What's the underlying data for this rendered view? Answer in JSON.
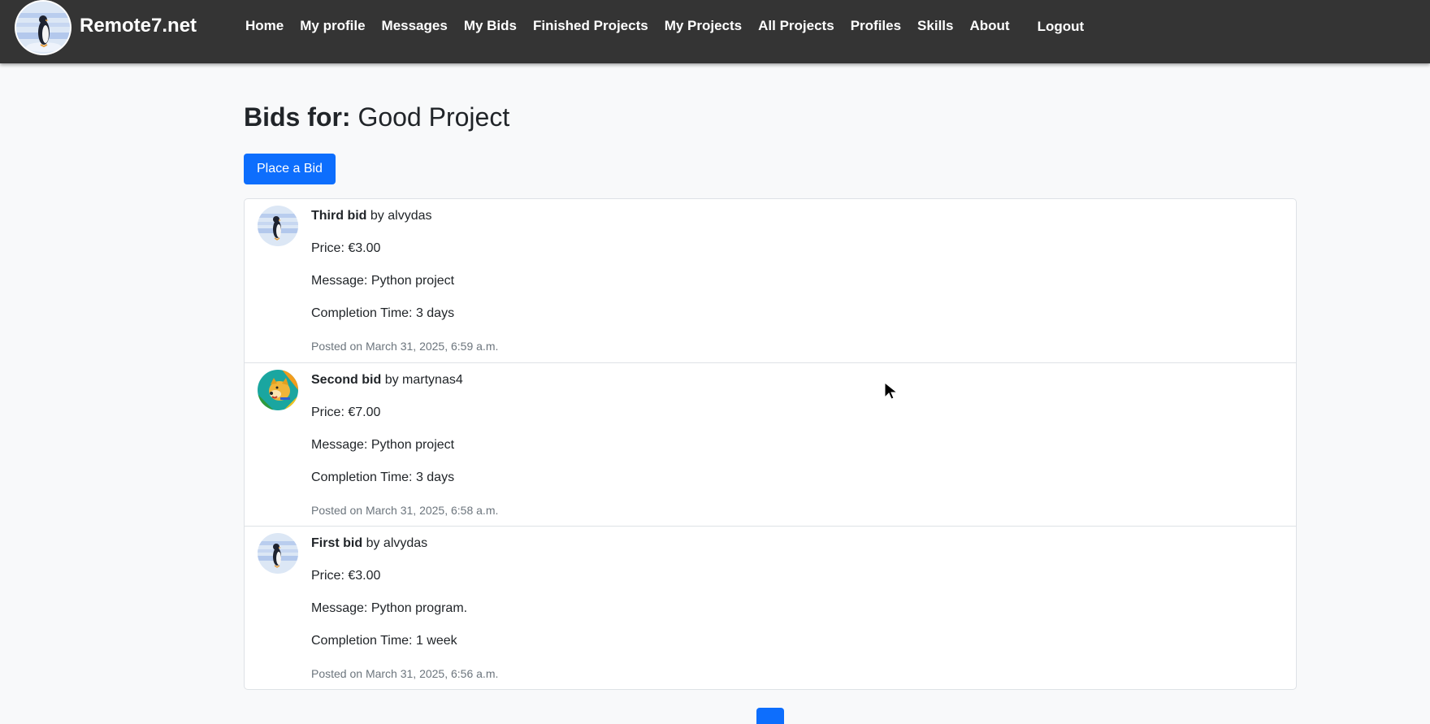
{
  "brand": {
    "name": "Remote7.net",
    "logo_icon": "penguin-logo-icon"
  },
  "nav": {
    "items": [
      {
        "label": "Home"
      },
      {
        "label": "My profile"
      },
      {
        "label": "Messages"
      },
      {
        "label": "My Bids"
      },
      {
        "label": "Finished Projects"
      },
      {
        "label": "My Projects"
      },
      {
        "label": "All Projects"
      },
      {
        "label": "Profiles"
      },
      {
        "label": "Skills"
      },
      {
        "label": "About"
      }
    ],
    "logout": "Logout"
  },
  "page": {
    "title_prefix": "Bids for:",
    "project_name": "Good Project",
    "place_bid_label": "Place a Bid"
  },
  "bids": [
    {
      "title": "Third bid",
      "by": "by",
      "user": "alvydas",
      "avatar": "penguin-avatar-icon",
      "price": "Price: €3.00",
      "message": "Message: Python project",
      "completion": "Completion Time: 3 days",
      "posted": "Posted on March 31, 2025, 6:59 a.m."
    },
    {
      "title": "Second bid",
      "by": "by",
      "user": "martynas4",
      "avatar": "dog-avatar-icon",
      "price": "Price: €7.00",
      "message": "Message: Python project",
      "completion": "Completion Time: 3 days",
      "posted": "Posted on March 31, 2025, 6:58 a.m."
    },
    {
      "title": "First bid",
      "by": "by",
      "user": "alvydas",
      "avatar": "penguin-avatar-icon",
      "price": "Price: €3.00",
      "message": "Message: Python program.",
      "completion": "Completion Time: 1 week",
      "posted": "Posted on March 31, 2025, 6:56 a.m."
    }
  ],
  "colors": {
    "navbar_bg": "#343434",
    "primary": "#0d6efd",
    "page_bg": "#f8f9fa",
    "muted": "#6c757d"
  }
}
